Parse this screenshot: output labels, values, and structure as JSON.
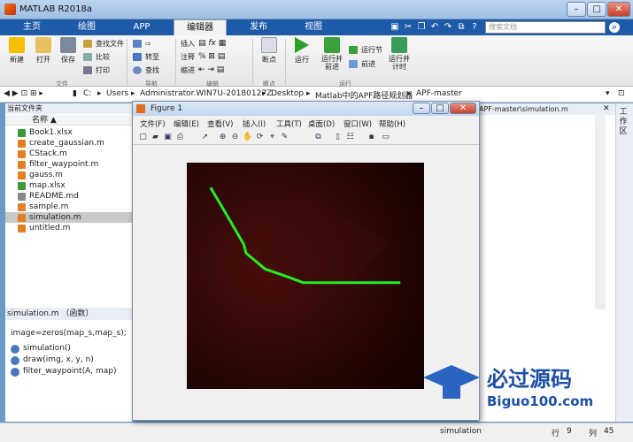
{
  "window": {
    "title": "MATLAB R2018a"
  },
  "tabs": [
    "主页",
    "绘图",
    "APP",
    "编辑器",
    "发布",
    "视图"
  ],
  "search": {
    "placeholder": "搜索文档"
  },
  "ribbon": {
    "file": {
      "new": "新建",
      "open": "打开",
      "save": "保存",
      "find_files": "查找文件",
      "compare": "比较",
      "print": "打印",
      "section": "文件"
    },
    "nav": {
      "goto": "转至",
      "find": "查找",
      "section": "导航"
    },
    "edit": {
      "insert": "插入",
      "comment": "注释",
      "indent": "缩进",
      "section": "编辑"
    },
    "breakpoints": {
      "label": "断点",
      "section": "断点"
    },
    "run": {
      "run": "运行",
      "run_advance": "运行并\n前进",
      "run_section": "运行节",
      "advance": "前进",
      "run_time": "运行并\n计时",
      "section": "运行"
    }
  },
  "address": [
    "C:",
    "Users",
    "Administrator.WIN7U-20180127Z",
    "Desktop",
    "Matlab中的APF路径规划器",
    "APF-master"
  ],
  "left_panel": {
    "title": "当前文件夹",
    "column": "名称 ▲",
    "files": [
      "Book1.xlsx",
      "create_gaussian.m",
      "CStack.m",
      "filter_waypoint.m",
      "gauss.m",
      "map.xlsx",
      "README.md",
      "sample.m",
      "simulation.m",
      "untitled.m"
    ],
    "selected_index": 8
  },
  "details": {
    "title": "simulation.m （函数）",
    "code": "image=zeros(map_s,map_s);",
    "functions": [
      "simulation()",
      "draw(img, x, y, n)",
      "filter_waypoint(A, map)"
    ]
  },
  "editor": {
    "tab_path": "APF-master\\simulation.m"
  },
  "workspace": {
    "label": "工\n作\n区"
  },
  "figure": {
    "title": "Figure 1",
    "menu": [
      "文件(F)",
      "编辑(E)",
      "查看(V)",
      "插入(I)",
      "工具(T)",
      "桌面(D)",
      "窗口(W)",
      "帮助(H)"
    ]
  },
  "status": {
    "file": "simulation",
    "row_label": "行",
    "row": "9",
    "col_label": "列",
    "col": "45"
  },
  "watermark": {
    "cn": "必过源码",
    "en": "Biguo100.com"
  },
  "path": {
    "color": "#22ee22",
    "points": [
      [
        0.1,
        0.11
      ],
      [
        0.14,
        0.18
      ],
      [
        0.24,
        0.36
      ],
      [
        0.25,
        0.4
      ],
      [
        0.33,
        0.47
      ],
      [
        0.44,
        0.51
      ],
      [
        0.49,
        0.53
      ],
      [
        0.9,
        0.53
      ]
    ]
  }
}
